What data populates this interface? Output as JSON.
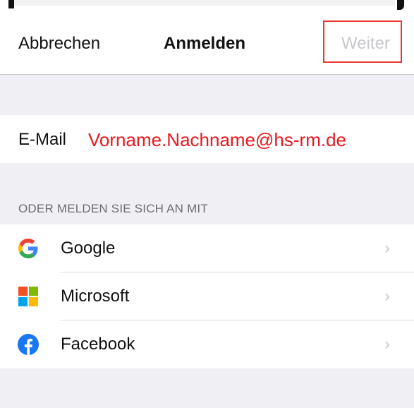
{
  "navbar": {
    "cancel_label": "Abbrechen",
    "title": "Anmelden",
    "next_label": "Weiter"
  },
  "email": {
    "label": "E-Mail",
    "value": "Vorname.Nachname@hs-rm.de"
  },
  "providers": {
    "header": "ODER MELDEN SIE SICH AN MIT",
    "items": [
      {
        "label": "Google",
        "icon": "google-icon"
      },
      {
        "label": "Microsoft",
        "icon": "microsoft-icon"
      },
      {
        "label": "Facebook",
        "icon": "facebook-icon"
      }
    ]
  },
  "colors": {
    "highlight": "#e53935",
    "email_text": "#e8181f",
    "disabled_text": "#c7c7cc",
    "background": "#efeff4"
  }
}
